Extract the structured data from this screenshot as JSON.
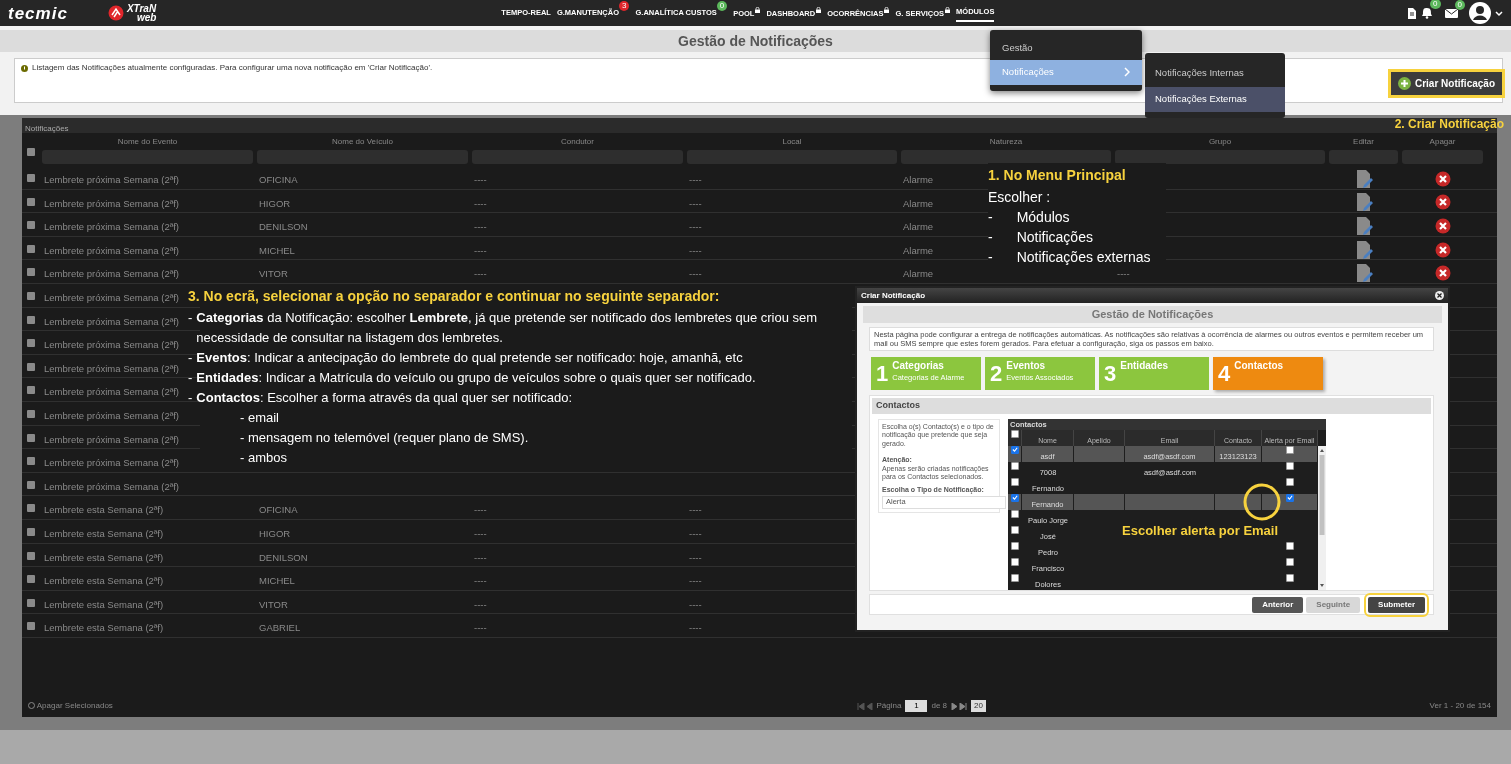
{
  "navbar": {
    "brand": "tecmic",
    "product": {
      "line1": "XTraN",
      "line2": "web"
    },
    "menu": [
      {
        "label": "TEMPO-REAL",
        "locked": false,
        "selected": false
      },
      {
        "label": "G.MANUTENÇÃO",
        "locked": false,
        "selected": false,
        "badge": {
          "text": "3",
          "color": "#e0262b"
        }
      },
      {
        "label": "G.ANALÍTICA CUSTOS",
        "locked": false,
        "selected": false,
        "badge": {
          "text": "0",
          "color": "#5cb85c"
        }
      },
      {
        "label": "POOL",
        "locked": true,
        "selected": false
      },
      {
        "label": "DASHBOARD",
        "locked": true,
        "selected": false
      },
      {
        "label": "OCORRÊNCIAS",
        "locked": true,
        "selected": false
      },
      {
        "label": "G. SERVIÇOS",
        "locked": true,
        "selected": false
      },
      {
        "label": "MÓDULOS",
        "locked": false,
        "selected": true
      }
    ],
    "alerts": [
      {
        "kind": "document"
      },
      {
        "kind": "bell",
        "badge": {
          "text": "0",
          "color": "#5cb85c"
        }
      },
      {
        "kind": "mail",
        "badge": {
          "text": "0",
          "color": "#5cb85c"
        }
      },
      {
        "kind": "avatar"
      },
      {
        "kind": "caret"
      }
    ]
  },
  "dropdown": {
    "items": [
      {
        "label": "Gestão",
        "selected": false,
        "has_submenu": false
      },
      {
        "label": "Notificações",
        "selected": true,
        "has_submenu": true
      }
    ],
    "submenu": [
      {
        "label": "Notificações Internas",
        "selected": false
      },
      {
        "label": "Notificações Externas",
        "selected": true
      }
    ]
  },
  "page": {
    "title": "Gestão de Notificações",
    "info": "Listagem das Notificações atualmente configuradas. Para configurar uma nova notificação em 'Criar Notificação'.",
    "create_button": "Criar Notificação",
    "create_highlighted": true
  },
  "grid": {
    "caption": "Notificações",
    "select_all": false,
    "columns": [
      "Nome do Evento",
      "Nome do Veículo",
      "Condutor",
      "Local",
      "Natureza",
      "Grupo",
      "Editar",
      "Apagar"
    ],
    "rows": [
      {
        "selected": false,
        "event": "Lembrete próxima Semana (2ªf)",
        "vehicle": "OFICINA",
        "driver": "----",
        "local": "----",
        "nature": "Alarme"
      },
      {
        "selected": false,
        "event": "Lembrete próxima Semana (2ªf)",
        "vehicle": "HIGOR",
        "driver": "----",
        "local": "----",
        "nature": "Alarme"
      },
      {
        "selected": false,
        "event": "Lembrete próxima Semana (2ªf)",
        "vehicle": "DENILSON",
        "driver": "----",
        "local": "----",
        "nature": "Alarme"
      },
      {
        "selected": false,
        "event": "Lembrete próxima Semana (2ªf)",
        "vehicle": "MICHEL",
        "driver": "----",
        "local": "----",
        "nature": "Alarme"
      },
      {
        "selected": false,
        "event": "Lembrete próxima Semana (2ªf)",
        "vehicle": "VITOR",
        "driver": "----",
        "local": "----",
        "nature": "Alarme",
        "group": "----"
      },
      {
        "selected": false,
        "event": "Lembrete próxima Semana (2ªf)"
      },
      {
        "selected": false,
        "event": "Lembrete próxima Semana (2ªf)"
      },
      {
        "selected": false,
        "event": "Lembrete próxima Semana (2ªf)"
      },
      {
        "selected": false,
        "event": "Lembrete próxima Semana (2ªf)"
      },
      {
        "selected": false,
        "event": "Lembrete próxima Semana (2ªf)"
      },
      {
        "selected": false,
        "event": "Lembrete próxima Semana (2ªf)"
      },
      {
        "selected": false,
        "event": "Lembrete próxima Semana (2ªf)"
      },
      {
        "selected": false,
        "event": "Lembrete próxima Semana (2ªf)"
      },
      {
        "selected": false,
        "event": "Lembrete próxima Semana (2ªf)"
      },
      {
        "selected": false,
        "event": "Lembrete esta Semana (2ªf)",
        "vehicle": "OFICINA",
        "driver": "----",
        "local": "----"
      },
      {
        "selected": false,
        "event": "Lembrete esta Semana (2ªf)",
        "vehicle": "HIGOR",
        "driver": "----",
        "local": "----"
      },
      {
        "selected": false,
        "event": "Lembrete esta Semana (2ªf)",
        "vehicle": "DENILSON",
        "driver": "----",
        "local": "----"
      },
      {
        "selected": false,
        "event": "Lembrete esta Semana (2ªf)",
        "vehicle": "MICHEL",
        "driver": "----",
        "local": "----"
      },
      {
        "selected": false,
        "event": "Lembrete esta Semana (2ªf)",
        "vehicle": "VITOR",
        "driver": "----",
        "local": "----"
      },
      {
        "selected": false,
        "event": "Lembrete esta Semana (2ªf)",
        "vehicle": "GABRIEL",
        "driver": "----",
        "local": "----"
      }
    ],
    "footer": {
      "delete_selected": "Apagar Selecionados",
      "page_label": "Página",
      "page": "1",
      "page_total": "de 8",
      "page_size": "20",
      "summary": "Ver 1 - 20 de 154"
    }
  },
  "modal": {
    "title": "Criar Notificação",
    "heading": "Gestão de Notificações",
    "info": "Nesta página pode configurar a entrega de notificações automáticas. As notificações são relativas à ocorrência de alarmes ou outros eventos e permitem receber um mail ou SMS sempre que estes forem gerados. Para efetuar a configuração, siga os passos em baixo.",
    "steps": [
      {
        "number": "1",
        "title": "Categorias",
        "subtitle": "Categorias de Alarme",
        "selected": false
      },
      {
        "number": "2",
        "title": "Eventos",
        "subtitle": "Eventos Associados",
        "selected": false
      },
      {
        "number": "3",
        "title": "Entidades",
        "selected": false
      },
      {
        "number": "4",
        "title": "Contactos",
        "selected": true
      }
    ],
    "section": "Contactos",
    "help": {
      "intro": "Escolha o(s) Contacto(s) e o tipo de notificação que pretende que seja gerado.",
      "warning_title": "Atenção:",
      "warning": "Apenas serão criadas notificações para os Contactos selecionados.",
      "type_label": "Escolha o Tipo de Notificação:",
      "type_value": "Alerta"
    },
    "contacts": {
      "caption": "Contactos",
      "select_all": false,
      "columns": [
        "Nome",
        "Apelido",
        "Email",
        "Contacto",
        "Alerta por Email"
      ],
      "rows": [
        {
          "selected": true,
          "name": "asdf",
          "email": "asdf@asdf.com",
          "contact": "123123123",
          "email_alert": false
        },
        {
          "selected": false,
          "name": "7008",
          "email": "asdf@asdf.com",
          "email_alert": false
        },
        {
          "selected": false,
          "name": "Fernando",
          "email_alert": false
        },
        {
          "selected": true,
          "name": "Fernando",
          "email_alert": true
        },
        {
          "selected": false,
          "name": "Paulo Jorge"
        },
        {
          "selected": false,
          "name": "José"
        },
        {
          "selected": false,
          "name": "Pedro",
          "email_alert": false
        },
        {
          "selected": false,
          "name": "Francisco",
          "email_alert": false
        },
        {
          "selected": false,
          "name": "Dolores",
          "email_alert": false
        }
      ]
    },
    "buttons": [
      {
        "label": "Anterior",
        "disabled": false,
        "highlighted": false
      },
      {
        "label": "Seguinte",
        "disabled": true,
        "highlighted": false
      },
      {
        "label": "Submeter",
        "disabled": false,
        "highlighted": true
      }
    ]
  },
  "annotations": {
    "step1": {
      "title": "1. No Menu Principal",
      "intro": "Escolher :",
      "items": [
        {
          "bullet": "-",
          "text": "Módulos"
        },
        {
          "bullet": "-",
          "text": "Notificações"
        },
        {
          "bullet": "-",
          "text": "Notificações externas"
        }
      ]
    },
    "step2": "2. Criar Notificação",
    "step3": {
      "title": "3. No ecrã, selecionar a opção no separador e continuar no seguinte separador:",
      "items": [
        {
          "bullet": "-",
          "text": "**Categorias** da Notificação: escolher **Lembrete**, já que pretende ser notificado dos lembretes que criou sem necessidade de consultar na listagem dos lembretes."
        },
        {
          "bullet": "-",
          "text": "**Eventos**: Indicar a antecipação do lembrete do qual pretende ser notificado: hoje, amanhã, etc"
        },
        {
          "bullet": "-",
          "text": "**Entidades**: Indicar a Matrícula do veículo ou grupo de veículos sobre o quais quer ser notificado."
        },
        {
          "bullet": "-",
          "text": "**Contactos**: Escolher a forma através da qual quer ser notificado:"
        }
      ],
      "subitems": [
        "- email",
        "- mensagem no telemóvel (requer plano de SMS).",
        "- ambos"
      ]
    },
    "step4": "Escolher alerta por Email"
  }
}
